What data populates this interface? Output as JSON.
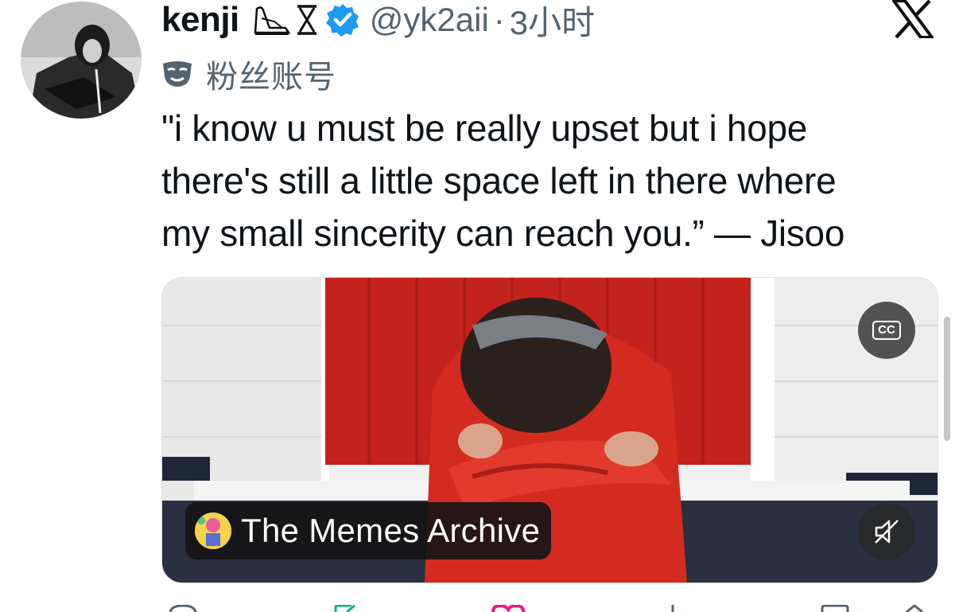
{
  "author": {
    "name": "kenji",
    "handle": "@yk2aii",
    "separator": "·",
    "time": "3小时",
    "name_emojis": [
      "swan-icon",
      "hourglass-icon"
    ],
    "verified": true
  },
  "fan_account": {
    "label": "粉丝账号",
    "icon": "mask-icon"
  },
  "tweet": {
    "line1": "\"i know u must be really upset but i hope",
    "line2": "there's still a little space left in there where",
    "line3": "my small sincerity can reach you.” — Jisoo"
  },
  "media": {
    "type": "video",
    "source_label": "The Memes Archive",
    "cc_label": "CC",
    "muted": true
  },
  "colors": {
    "verified_blue": "#1d9bf0",
    "text_primary": "#0f1419",
    "text_secondary": "#536471",
    "wall_red": "#c4221d",
    "reply_icon_color": "#536471",
    "retweet_icon_color": "#00ba7c",
    "like_icon_color": "#f91880"
  },
  "actions": [
    "reply-icon",
    "retweet-icon",
    "like-icon",
    "views-icon",
    "bookmark-icon",
    "share-icon"
  ]
}
